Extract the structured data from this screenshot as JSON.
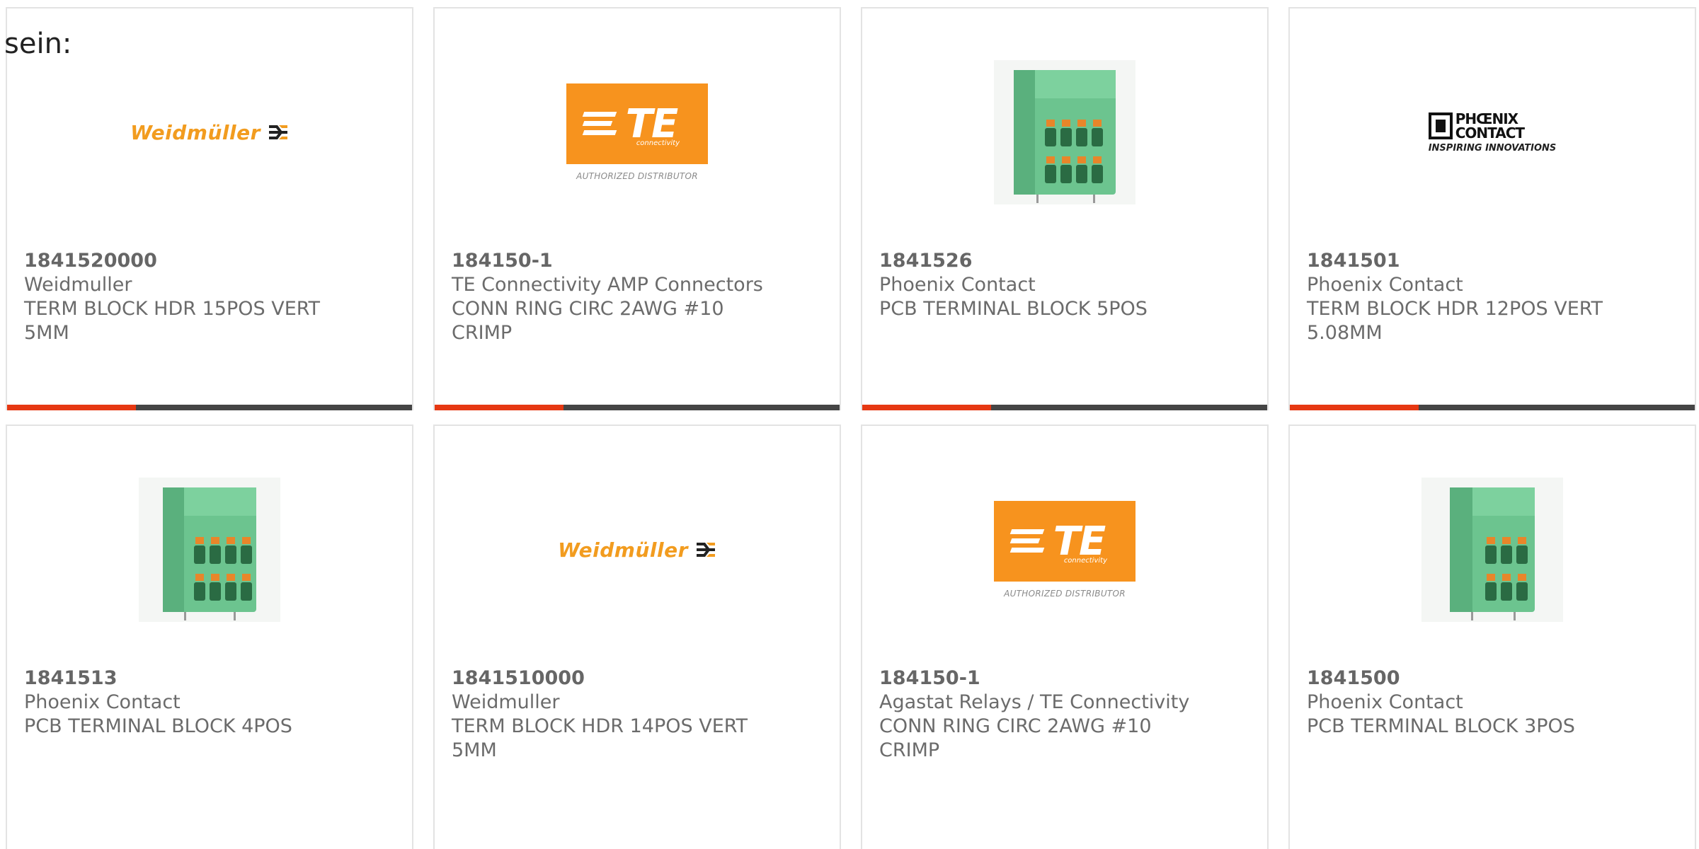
{
  "lead_text": "sein:",
  "colors": {
    "accent_bar": "#e63812",
    "bar": "#454545",
    "weidmuller_orange": "#f29c1f",
    "te_orange": "#f7931e",
    "terminal_green": "#5fbf85"
  },
  "logos": {
    "weidmuller": "Weidmüller",
    "te": "TE",
    "te_sub": "connectivity",
    "te_authorized": "AUTHORIZED DISTRIBUTOR",
    "phoenix_line1": "PHŒNIX",
    "phoenix_line2": "CONTACT",
    "phoenix_tagline": "INSPIRING INNOVATIONS"
  },
  "products": [
    {
      "part_number": "1841520000",
      "manufacturer": "Weidmuller",
      "desc_line1": "TERM BLOCK HDR 15POS VERT",
      "desc_line2": "5MM",
      "image": "weidmuller-logo"
    },
    {
      "part_number": "184150-1",
      "manufacturer": "TE Connectivity AMP Connectors",
      "desc_line1": "CONN RING CIRC 2AWG #10",
      "desc_line2": "CRIMP",
      "image": "te-logo"
    },
    {
      "part_number": "1841526",
      "manufacturer": "Phoenix Contact",
      "desc_line1": "PCB TERMINAL BLOCK 5POS",
      "desc_line2": "",
      "image": "terminal-block-photo"
    },
    {
      "part_number": "1841501",
      "manufacturer": "Phoenix Contact",
      "desc_line1": "TERM BLOCK HDR 12POS VERT",
      "desc_line2": "5.08MM",
      "image": "phoenix-contact-logo"
    },
    {
      "part_number": "1841513",
      "manufacturer": "Phoenix Contact",
      "desc_line1": "PCB TERMINAL BLOCK 4POS",
      "desc_line2": "",
      "image": "terminal-block-photo"
    },
    {
      "part_number": "1841510000",
      "manufacturer": "Weidmuller",
      "desc_line1": "TERM BLOCK HDR 14POS VERT",
      "desc_line2": "5MM",
      "image": "weidmuller-logo"
    },
    {
      "part_number": "184150-1",
      "manufacturer": "Agastat Relays / TE Connectivity",
      "desc_line1": "CONN RING CIRC 2AWG #10",
      "desc_line2": "CRIMP",
      "image": "te-logo"
    },
    {
      "part_number": "1841500",
      "manufacturer": "Phoenix Contact",
      "desc_line1": "PCB TERMINAL BLOCK 3POS",
      "desc_line2": "",
      "image": "terminal-block-photo"
    }
  ]
}
